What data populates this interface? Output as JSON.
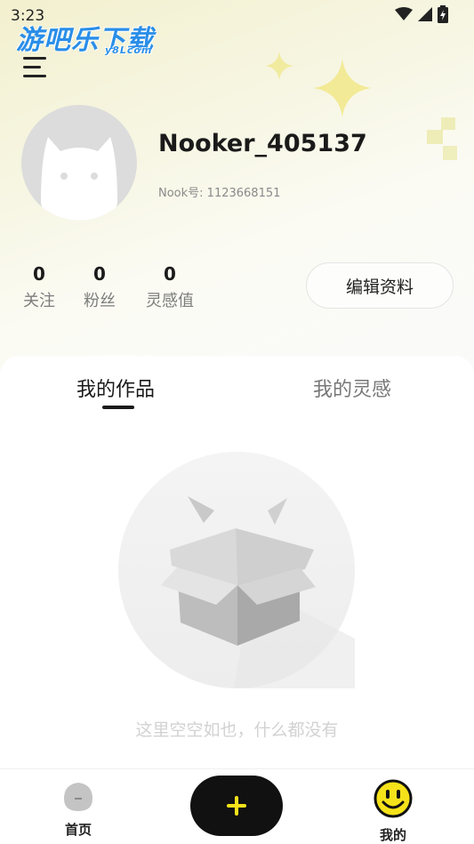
{
  "status_bar": {
    "time": "3:23"
  },
  "watermark": {
    "text": "游吧乐下载",
    "sub": "y8Lcom"
  },
  "profile": {
    "username": "Nooker_405137",
    "nook_id": "Nook号: 1123668151"
  },
  "stats": [
    {
      "value": "0",
      "label": "关注"
    },
    {
      "value": "0",
      "label": "粉丝"
    },
    {
      "value": "0",
      "label": "灵感值"
    }
  ],
  "edit_button": {
    "label": "编辑资料"
  },
  "tabs": [
    {
      "label": "我的作品",
      "active": true
    },
    {
      "label": "我的灵感",
      "active": false
    }
  ],
  "empty_state": {
    "text": "这里空空如也，什么都没有"
  },
  "bottom_nav": {
    "home_label": "首页",
    "add_symbol": "+",
    "mine_label": "我的"
  },
  "colors": {
    "accent": "#f5e21a",
    "dark": "#111111"
  }
}
